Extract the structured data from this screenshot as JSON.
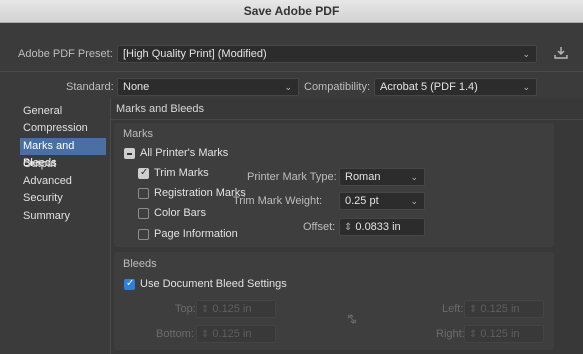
{
  "window": {
    "title": "Save Adobe PDF"
  },
  "preset": {
    "label": "Adobe PDF Preset:",
    "value": "[High Quality Print] (Modified)"
  },
  "standard": {
    "label": "Standard:",
    "value": "None"
  },
  "compatibility": {
    "label": "Compatibility:",
    "value": "Acrobat 5 (PDF 1.4)"
  },
  "sidebar": {
    "items": [
      {
        "label": "General"
      },
      {
        "label": "Compression"
      },
      {
        "label": "Marks and Bleeds",
        "selected": true
      },
      {
        "label": "Output"
      },
      {
        "label": "Advanced"
      },
      {
        "label": "Security"
      },
      {
        "label": "Summary"
      }
    ]
  },
  "panel": {
    "title": "Marks and Bleeds"
  },
  "marks": {
    "heading": "Marks",
    "all_printers_marks": "All Printer's Marks",
    "trim_marks": "Trim Marks",
    "registration_marks": "Registration Marks",
    "color_bars": "Color Bars",
    "page_information": "Page Information",
    "mark_type_label": "Printer Mark Type:",
    "mark_type_value": "Roman",
    "weight_label": "Trim Mark Weight:",
    "weight_value": "0.25 pt",
    "offset_label": "Offset:",
    "offset_value": "0.0833 in"
  },
  "bleeds": {
    "heading": "Bleeds",
    "use_doc_bleed": "Use Document Bleed Settings",
    "top_label": "Top:",
    "bottom_label": "Bottom:",
    "left_label": "Left:",
    "right_label": "Right:",
    "top_value": "0.125 in",
    "bottom_value": "0.125 in",
    "left_value": "0.125 in",
    "right_value": "0.125 in"
  },
  "colors": {
    "accent": "#2d7fe0",
    "selection": "#4a6fa5"
  }
}
